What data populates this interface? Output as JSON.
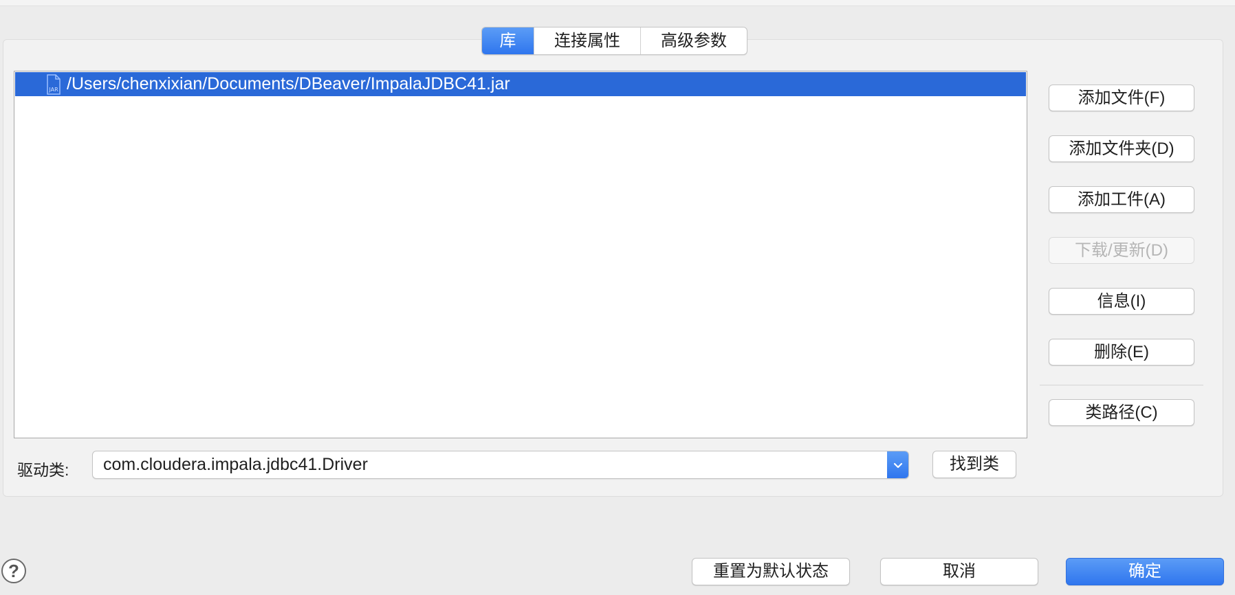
{
  "tabs": [
    {
      "label": "库",
      "active": true
    },
    {
      "label": "连接属性",
      "active": false
    },
    {
      "label": "高级参数",
      "active": false
    }
  ],
  "libraries": [
    {
      "path": "/Users/chenxixian/Documents/DBeaver/ImpalaJDBC41.jar",
      "icon": "jar-file-icon",
      "selected": true
    }
  ],
  "side_buttons": {
    "add_file": "添加文件(F)",
    "add_folder": "添加文件夹(D)",
    "add_artifact": "添加工件(A)",
    "download_update": "下载/更新(D)",
    "info": "信息(I)",
    "delete": "删除(E)",
    "classpath": "类路径(C)"
  },
  "driver_class": {
    "label": "驱动类:",
    "value": "com.cloudera.impala.jdbc41.Driver",
    "find_button": "找到类"
  },
  "footer": {
    "reset": "重置为默认状态",
    "cancel": "取消",
    "ok": "确定",
    "help_icon": "help-icon"
  },
  "colors": {
    "accent": "#2f76ee",
    "selection": "#2a69d8",
    "disabled_text": "#b5b5b5"
  }
}
